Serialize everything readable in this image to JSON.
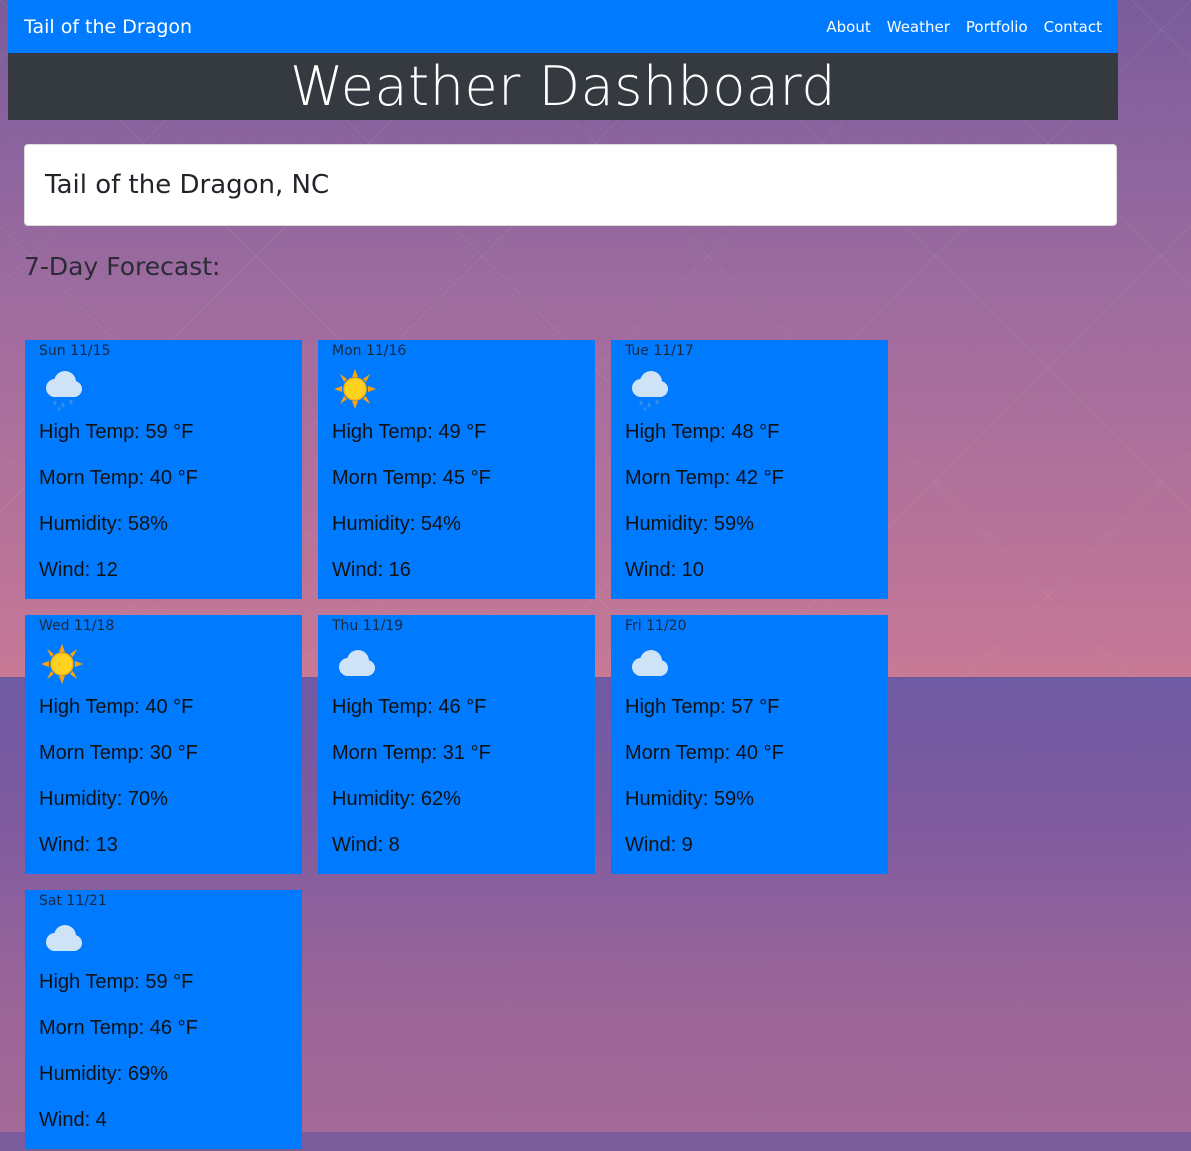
{
  "nav": {
    "brand": "Tail of the Dragon",
    "links": [
      "About",
      "Weather",
      "Portfolio",
      "Contact"
    ]
  },
  "header": {
    "title": "Weather Dashboard"
  },
  "city": {
    "name": "Tail of the Dragon, NC"
  },
  "forecast": {
    "title": "7-Day Forecast:",
    "days": [
      {
        "date": "Sun 11/15",
        "icon": "rain-cloud-icon",
        "high": "High Temp: 59 °F",
        "morn": "Morn Temp: 40 °F",
        "humidity": "Humidity: 58%",
        "wind": "Wind: 12"
      },
      {
        "date": "Mon 11/16",
        "icon": "sun-icon",
        "high": "High Temp: 49 °F",
        "morn": "Morn Temp: 45 °F",
        "humidity": "Humidity: 54%",
        "wind": "Wind: 16"
      },
      {
        "date": "Tue 11/17",
        "icon": "rain-cloud-icon",
        "high": "High Temp: 48 °F",
        "morn": "Morn Temp: 42 °F",
        "humidity": "Humidity: 59%",
        "wind": "Wind: 10"
      },
      {
        "date": "Wed 11/18",
        "icon": "sun-icon",
        "high": "High Temp: 40 °F",
        "morn": "Morn Temp: 30 °F",
        "humidity": "Humidity: 70%",
        "wind": "Wind: 13"
      },
      {
        "date": "Thu 11/19",
        "icon": "cloud-icon",
        "high": "High Temp: 46 °F",
        "morn": "Morn Temp: 31 °F",
        "humidity": "Humidity: 62%",
        "wind": "Wind: 8"
      },
      {
        "date": "Fri 11/20",
        "icon": "cloud-icon",
        "high": "High Temp: 57 °F",
        "morn": "Morn Temp: 40 °F",
        "humidity": "Humidity: 59%",
        "wind": "Wind: 9"
      },
      {
        "date": "Sat 11/21",
        "icon": "cloud-icon",
        "high": "High Temp: 59 °F",
        "morn": "Morn Temp: 46 °F",
        "humidity": "Humidity: 69%",
        "wind": "Wind: 4"
      }
    ]
  },
  "colors": {
    "navbar": "#007bff",
    "jumbotron": "#343a40",
    "card": "#007bff"
  }
}
